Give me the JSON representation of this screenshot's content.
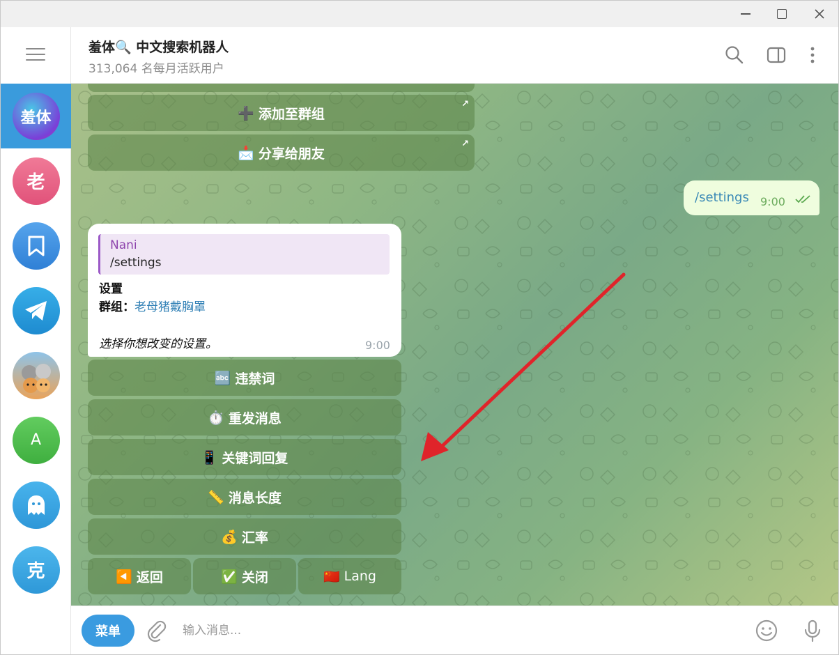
{
  "window": {
    "controls": {
      "minimize": "minimize-icon",
      "maximize": "maximize-icon",
      "close": "close-icon"
    }
  },
  "sidebar": {
    "chats": [
      {
        "initial": "羞体",
        "color": "#7b4fd6",
        "active": true
      },
      {
        "initial": "老",
        "color": "#e86a8c",
        "active": false
      },
      {
        "icon": "bookmark-icon",
        "color": "#3c8fe0",
        "active": false
      },
      {
        "icon": "telegram-icon",
        "color": "#2a9ee0",
        "active": false
      },
      {
        "icon": "cats-avatar",
        "color": "#7fb3d8",
        "active": false
      },
      {
        "initial": "A",
        "color": "#4fbf4f",
        "active": false
      },
      {
        "icon": "ghost-icon",
        "color": "#3ea5e3",
        "active": false
      },
      {
        "initial": "克",
        "color": "#3aa7df",
        "active": false
      }
    ]
  },
  "header": {
    "title": "羞体🔍 中文搜索机器人",
    "subtitle": "313,064 名每月活跃用户"
  },
  "chat": {
    "top_buttons": [
      {
        "icon": "➕",
        "label": "添加至群组"
      },
      {
        "icon": "📩",
        "label": "分享给朋友"
      }
    ],
    "outgoing": {
      "text": "/settings",
      "time": "9:00"
    },
    "incoming": {
      "quote_name": "Nani",
      "quote_text": "/settings",
      "line1": "设置",
      "group_label": "群组：",
      "group_name": "老母猪戴胸罩",
      "line3": "选择你想改变的设置。",
      "time": "9:00"
    },
    "keyboard": [
      {
        "icon": "🔤",
        "label": "违禁词"
      },
      {
        "icon": "⏱️",
        "label": "重发消息"
      },
      {
        "icon": "📱",
        "label": "关键词回复"
      },
      {
        "icon": "📏",
        "label": "消息长度"
      },
      {
        "icon": "💰",
        "label": "汇率"
      }
    ],
    "bottom_row": [
      {
        "icon": "◀️",
        "label": "返回"
      },
      {
        "icon": "✅",
        "label": "关闭"
      },
      {
        "icon": "🇨🇳",
        "label": "Lang"
      }
    ]
  },
  "input": {
    "menu_label": "菜单",
    "placeholder": "输入消息..."
  }
}
